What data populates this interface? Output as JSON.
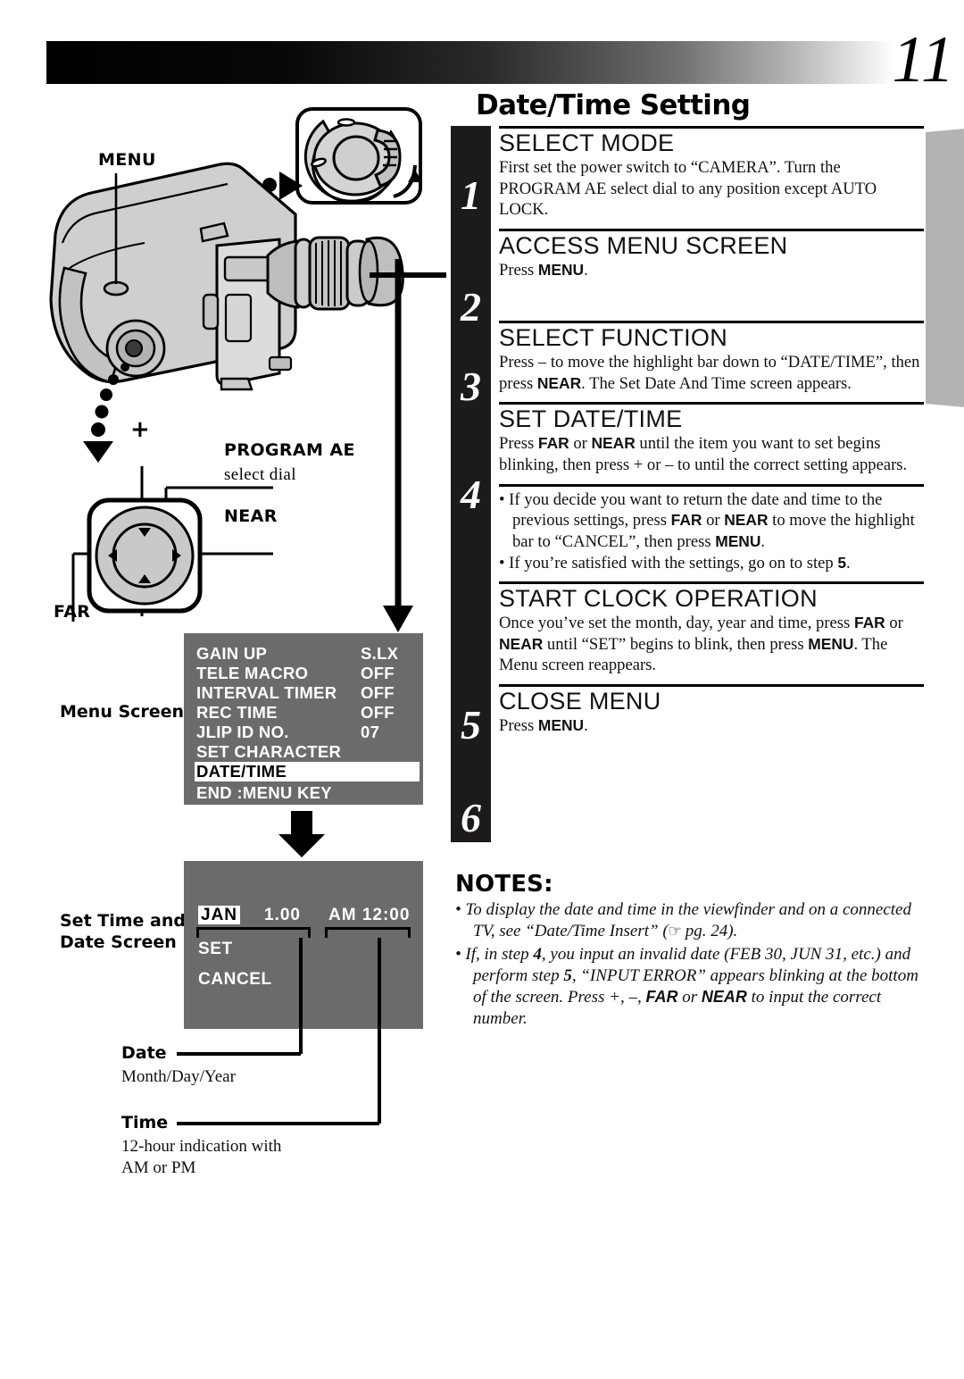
{
  "page": {
    "number": "11",
    "section_title": "Date/Time Setting"
  },
  "camera_callouts": {
    "menu": "MENU",
    "program_ae_line1": "PROGRAM AE",
    "program_ae_line2": "select dial",
    "near": "NEAR",
    "far": "FAR",
    "plus": "+",
    "minus": "–"
  },
  "figure_labels": {
    "menu_screen": "Menu Screen",
    "set_screen_line1": "Set Time and",
    "set_screen_line2": "Date Screen",
    "date_label": "Date",
    "date_desc": "Month/Day/Year",
    "time_label": "Time",
    "time_desc_line1": "12-hour indication with",
    "time_desc_line2": "AM or PM"
  },
  "menu_screen": {
    "rows": [
      {
        "key": "GAIN UP",
        "value": "S.LX",
        "highlighted": false
      },
      {
        "key": "TELE MACRO",
        "value": "OFF",
        "highlighted": false
      },
      {
        "key": "INTERVAL TIMER",
        "value": "OFF",
        "highlighted": false
      },
      {
        "key": "REC TIME",
        "value": "OFF",
        "highlighted": false
      },
      {
        "key": "JLIP ID NO.",
        "value": "07",
        "highlighted": false
      },
      {
        "key": "SET CHARACTER",
        "value": "",
        "highlighted": false
      },
      {
        "key": "DATE/TIME",
        "value": "",
        "highlighted": true
      }
    ],
    "footer": "END :MENU KEY"
  },
  "date_screen": {
    "month": "JAN",
    "day_year": "1.00",
    "time": "AM 12:00",
    "set": "SET",
    "cancel": "CANCEL"
  },
  "steps": [
    {
      "number": "1",
      "title": "SELECT MODE",
      "body": "First set the power switch to “CAMERA”. Turn the PROGRAM AE select dial to any position except AUTO LOCK."
    },
    {
      "number": "2",
      "title": "ACCESS MENU SCREEN",
      "body_pre": "Press ",
      "body_bold": "MENU",
      "body_post": "."
    },
    {
      "number": "3",
      "title": "SELECT FUNCTION",
      "body_pre": "Press – to move the highlight bar down to “DATE/TIME”, then press ",
      "body_bold": "NEAR",
      "body_post": ". The Set Date And Time screen appears."
    },
    {
      "number": "4",
      "title": "SET DATE/TIME",
      "body_pre": "Press ",
      "body_bold": "FAR",
      "body_mid": " or ",
      "body_bold2": "NEAR",
      "body_post": " until the item you want to set begins blinking, then press + or – to until the correct setting appears."
    },
    {
      "number": "5",
      "title": "START CLOCK OPERATION",
      "body_pre": "Once you’ve set the month, day, year and time, press ",
      "body_bold": "FAR",
      "body_mid": " or ",
      "body_bold2": "NEAR",
      "body_mid2": " until “SET” begins to blink, then press ",
      "body_bold3": "MENU",
      "body_post": ". The Menu screen reappears."
    },
    {
      "number": "6",
      "title": "CLOSE MENU",
      "body_pre": "Press ",
      "body_bold": "MENU",
      "body_post": "."
    }
  ],
  "step4_bullets": {
    "b1_pre": "• If you decide you want to return the date and time to the previous settings, press ",
    "b1_bold": "FAR",
    "b1_mid": " or ",
    "b1_bold2": "NEAR",
    "b1_mid2": " to move the highlight bar to “CANCEL”, then press ",
    "b1_bold3": "MENU",
    "b1_post": ".",
    "b2_pre": "• If you’re satisfied with the settings, go on to step ",
    "b2_bold": "5",
    "b2_post": "."
  },
  "notes": {
    "heading": "NOTES:",
    "n1_pre": "To display the date and time in the viewfinder and on a connected TV, see “Date/Time Insert” (",
    "n1_hand": "☞",
    "n1_post": " pg. 24).",
    "n2_pre": "If, in step ",
    "n2_b1": "4",
    "n2_mid": ", you input an invalid date (FEB 30, JUN 31, etc.) and perform step ",
    "n2_b2": "5",
    "n2_mid2": ", “INPUT ERROR” appears blinking at the bottom of the screen. Press +, –, ",
    "n2_b3": "FAR",
    "n2_mid3": " or ",
    "n2_b4": "NEAR",
    "n2_post": " to input the correct number."
  },
  "colors": {
    "osd_background": "#6b6b6b",
    "step_bar": "#1c1a1a",
    "right_tab": "#b3b3b3"
  }
}
